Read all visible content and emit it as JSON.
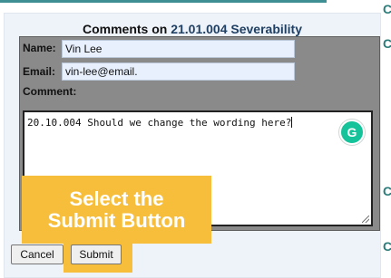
{
  "panel": {
    "title_prefix": "Comments on",
    "title_link": "21.01.004 Severability"
  },
  "form": {
    "name_label": "Name:",
    "name_value": "Vin Lee",
    "email_label": "Email:",
    "email_value": "vin-lee@email.",
    "comment_label": "Comment:",
    "comment_value": "20.10.004 Should we change the wording here?"
  },
  "callout": {
    "line1": "Select the",
    "line2": "Submit Button"
  },
  "buttons": {
    "cancel": "Cancel",
    "submit": "Submit"
  },
  "grammarly": {
    "icon": "grammarly-icon",
    "glyph": "G"
  },
  "sidebar_fragments": [
    "C",
    "C",
    "C",
    "C"
  ],
  "colors": {
    "accent_bar": "#3d8f94",
    "callout": "#f6be3a",
    "title_link": "#1f3f63",
    "grammarly": "#15c39a"
  }
}
